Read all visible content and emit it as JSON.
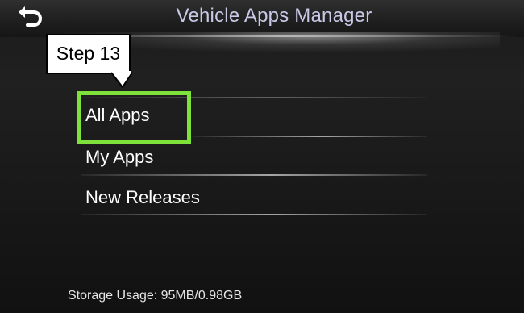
{
  "header": {
    "title": "Vehicle Apps Manager",
    "back_icon": "back-arrow-icon"
  },
  "callout": {
    "label": "Step 13",
    "highlight_color": "#7ee23b"
  },
  "menu": {
    "items": [
      {
        "label": "All Apps"
      },
      {
        "label": "My Apps"
      },
      {
        "label": "New Releases"
      }
    ]
  },
  "status": {
    "storage": "Storage Usage: 95MB/0.98GB"
  },
  "colors": {
    "title_text": "#c9c8e6",
    "menu_text": "#ffffff",
    "background": "#1a1a1a"
  }
}
